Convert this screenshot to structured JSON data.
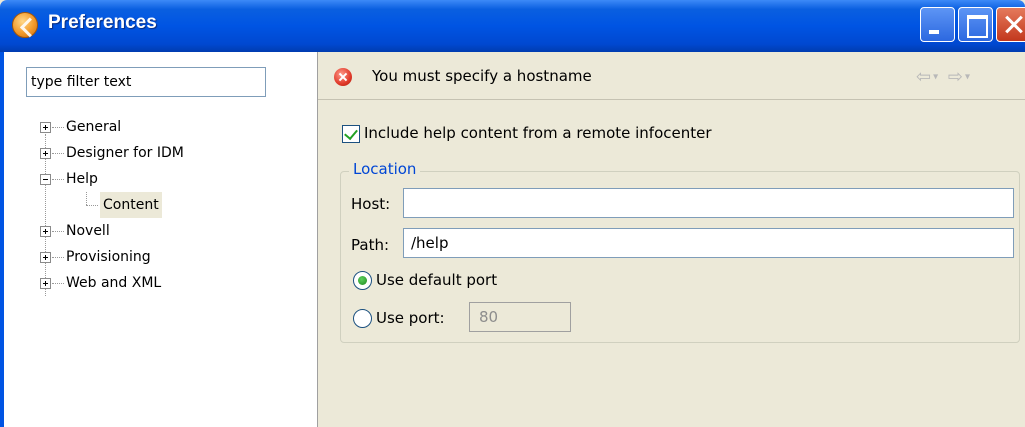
{
  "window": {
    "title": "Preferences"
  },
  "filter": {
    "value": "type filter text"
  },
  "tree": {
    "items": [
      "General",
      "Designer for IDM",
      "Help",
      "Content",
      "Novell",
      "Provisioning",
      "Web and XML"
    ]
  },
  "message": {
    "text": "You must specify a hostname"
  },
  "page": {
    "checkbox_label": "Include help content from a remote infocenter",
    "checkbox_checked": true,
    "group_title": "Location",
    "host_label": "Host:",
    "host_value": "",
    "path_label": "Path:",
    "path_value": "/help",
    "default_port_label": "Use default port",
    "use_port_label": "Use port:",
    "port_value": "80"
  },
  "colors": {
    "titlebar": "#0054e3",
    "dialog_bg": "#ece9d8",
    "group_title": "#0046d5",
    "error": "#e03a2a"
  }
}
